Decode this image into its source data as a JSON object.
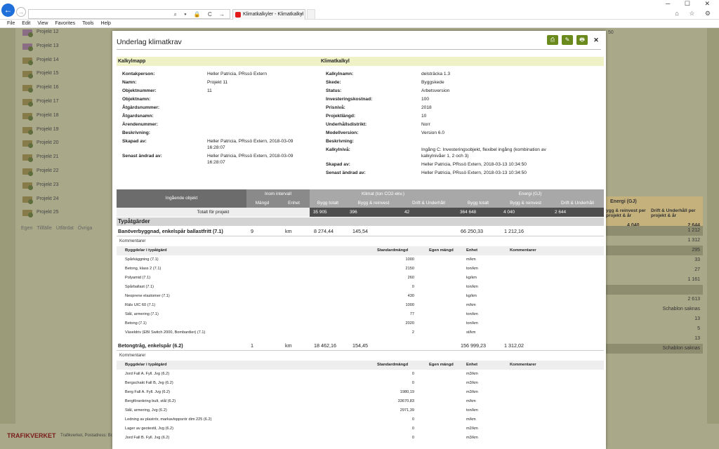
{
  "browser": {
    "tab_title": "Klimatkalkyler - Klimatkalkyl",
    "tab_close": "×",
    "addr_icons": "⌕ ▾ 🔒 C →",
    "window_controls": "─ ☐ ✕",
    "right_icons": "⌂ ☆ ⚙",
    "menu": [
      "File",
      "Edit",
      "View",
      "Favorites",
      "Tools",
      "Help"
    ]
  },
  "background": {
    "projects": [
      "Projekt 12",
      "Projekt 13",
      "Projekt 14",
      "Projekt 15",
      "Projekt 16",
      "Projekt 17",
      "Projekt 18",
      "Projekt 19",
      "Projekt 20",
      "Projekt 21",
      "Projekt 22",
      "Projekt 23",
      "Projekt 24",
      "Projekt 25"
    ],
    "legend": [
      "Egen",
      "Tillfälle",
      "Utfärdat",
      "Övriga"
    ],
    "top_value": "50",
    "energy_head": "Energi (GJ)",
    "bygg_head": "ygg & reinvest per projekt & år",
    "drift_head": "Drift & Underhåll per projekt & år",
    "head_vals": [
      "4 040",
      "2 644"
    ],
    "rows": [
      "1 212",
      "1 312",
      "295",
      "33",
      "27",
      "1 161",
      "",
      "2 613",
      "Schablon saknas",
      "13",
      "5",
      "13",
      "Schablon saknas"
    ],
    "footer_logo": "TRAFIKVERKET",
    "footer_text": "Trafikverket, Postadress: Bo"
  },
  "modal": {
    "title": "Underlag klimatkrav",
    "buttons": [
      "⎙",
      "✎",
      "🖶"
    ],
    "close": "✕",
    "left_header": "Kalkylmapp",
    "right_header": "Klimatkalkyl",
    "left_fields": [
      {
        "k": "Kontakperson:",
        "v": "Heller Patricia, PRssö Extern"
      },
      {
        "k": "Namn:",
        "v": "Projekt 11"
      },
      {
        "k": "Objektnummer:",
        "v": "11"
      },
      {
        "k": "Objektnamn:",
        "v": ""
      },
      {
        "k": "Åtgärdsnummer:",
        "v": ""
      },
      {
        "k": "Åtgardsnamn:",
        "v": ""
      },
      {
        "k": "Ärendenummer:",
        "v": ""
      },
      {
        "k": "Beskrivning:",
        "v": ""
      },
      {
        "k": "Skapad av:",
        "v": "Heller Patricia, PRssö Extern, 2018-03-09",
        "v2": "16:28:07"
      },
      {
        "k": "Senast ändrad av:",
        "v": "Heller Patricia, PRssö Extern, 2018-03-09",
        "v2": "16:28:07"
      }
    ],
    "right_fields": [
      {
        "k": "Kalkylnamn:",
        "v": "delsträcka 1.3"
      },
      {
        "k": "Skede:",
        "v": "Byggskede"
      },
      {
        "k": "Status:",
        "v": "Arbetsversion"
      },
      {
        "k": "Investeringskostnad:",
        "v": "100"
      },
      {
        "k": "Prisnivå:",
        "v": "2018"
      },
      {
        "k": "Projektlängd:",
        "v": "10"
      },
      {
        "k": "Underhållsdistrikt:",
        "v": "Norr"
      },
      {
        "k": "Modellversion:",
        "v": "Version 6.0"
      },
      {
        "k": "Beskrivning:",
        "v": ""
      },
      {
        "k": "Kalkylnivå:",
        "v": "Ingång C: Investeringsobjekt, flexibel ingång (kombination av",
        "v2": "kalkylnivåer 1, 2 och 3)"
      },
      {
        "k": "Skapad av:",
        "v": "Heller Patricia, PRssö Extern, 2018-03-13 10:34:50"
      },
      {
        "k": "Senast ändrad av:",
        "v": "Heller Patricia, PRssö Extern, 2018-03-13 10:34:50"
      }
    ],
    "summary": {
      "ingaende": "Ingående objekt",
      "inom": "Inom intervall",
      "klimat": "Klimat (ton CO2-ekv.)",
      "energi": "Energi (GJ)",
      "mangd": "Mängd",
      "enhet": "Enhet",
      "bygg_totalt": "Bygg totalt",
      "bygg_reinvest": "Bygg & reinvest",
      "drift": "Drift & Underhåll",
      "totalt_label": "Totalt för projekt",
      "totals": [
        "35 905",
        "396",
        "42",
        "364 648",
        "4 040",
        "2 644"
      ]
    },
    "typatgarder": "Typåtgärder",
    "objects": [
      {
        "name": "Banöverbyggnad, enkelspår ballastfritt (7.1)",
        "mangd": "9",
        "enhet": "km",
        "bt": "8 274,44",
        "br": "145,54",
        "eb": "66 250,33",
        "er": "1 212,16",
        "komm": "Kommentarer",
        "head": [
          "Byggdelar i typåtgärd",
          "Standardmängd",
          "Egen mängd",
          "Enhet",
          "Kommentarer"
        ],
        "rows": [
          [
            "Spårkäggning (7.1)",
            "1000",
            "m/km"
          ],
          [
            "Betong, klass 2 (7.1)",
            "2150",
            "ton/km"
          ],
          [
            "Polyamid (7.1)",
            "260",
            "kg/km"
          ],
          [
            "Spårballast (7.1)",
            "0",
            "ton/km"
          ],
          [
            "Neoprene elastomer (7.1)",
            "430",
            "kg/km"
          ],
          [
            "Räls UIC 60 (7.1)",
            "1000",
            "m/km"
          ],
          [
            "Stål, armering (7.1)",
            "77",
            "ton/km"
          ],
          [
            "Betong (7.1)",
            "2020",
            "ton/km"
          ],
          [
            "Växeldriv (EBI Switch 2000, Bombardier) (7.1)",
            "2",
            "st/km"
          ]
        ]
      },
      {
        "name": "Betongtråg, enkelspår (6.2)",
        "mangd": "1",
        "enhet": "km",
        "bt": "18 462,16",
        "br": "154,45",
        "eb": "156 999,23",
        "er": "1 312,02",
        "komm": "Kommentarer",
        "head": [
          "Byggdelar i typåtgärd",
          "Standardmängd",
          "Egen mängd",
          "Enhet",
          "Kommentarer"
        ],
        "rows": [
          [
            "Jord Fall A. Fyll. Jvg (6.2)",
            "0",
            "m3/km"
          ],
          [
            "Bergschakt Fall B, Jvg (6.2)",
            "0",
            "m3/km"
          ],
          [
            "Berg Fall A. Fyll. Jvg (6.2)",
            "1980,19",
            "m3/km"
          ],
          [
            "Bergförankring bult, stål (6.2)",
            "33670,83",
            "m/km"
          ],
          [
            "Stål, armering, Jvg (6.2)",
            "2971,39",
            "ton/km"
          ],
          [
            "Ledning av plaströr, markavloppsrör dim 225 (6.2)",
            "0",
            "m/km"
          ],
          [
            "Lager av geotextil, Jvg (6.2)",
            "0",
            "m2/km"
          ],
          [
            "Jord Fall B. Fyll. Jvg (6.2)",
            "0",
            "m3/km"
          ]
        ]
      }
    ]
  }
}
